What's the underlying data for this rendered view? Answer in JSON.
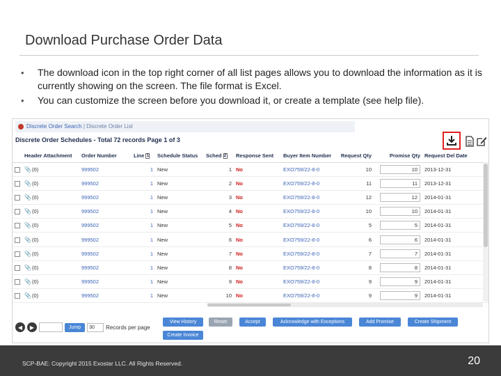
{
  "slide": {
    "title": "Download Purchase Order Data",
    "bullets": [
      "The download icon in the top right corner of all list pages allows you to download the information as it is currently showing on the screen.  The file format is Excel.",
      "You can customize the screen before you download it, or create a template (see help file)."
    ],
    "footer_text": "SCP-BAE:  Copyright 2015 Exostar LLC. All Rights Reserved.",
    "page_number": "20"
  },
  "app": {
    "breadcrumb": {
      "link": "Discrete Order Search",
      "separator": " | ",
      "current": "Discrete Order List"
    },
    "panel_title": "Discrete Order Schedules - Total 72 records Page 1 of 3",
    "toolbar_icons": [
      "download-icon",
      "document-icon",
      "edit-icon"
    ],
    "columns": [
      "Header Attachment",
      "Order Number",
      "Line",
      "Schedule Status",
      "Sched",
      "Response Sent",
      "Buyer Item Number",
      "Request Qty",
      "Promise Qty",
      "Request Del Date"
    ],
    "rows": [
      {
        "attachment": "(0)",
        "order": "999502",
        "line": "1",
        "status": "New",
        "sched": "1",
        "response": "No",
        "item": "EXO759/22-8-0",
        "req_qty": "10",
        "promise_qty": "10",
        "date": "2013-12-31"
      },
      {
        "attachment": "(0)",
        "order": "999502",
        "line": "1",
        "status": "New",
        "sched": "2",
        "response": "No",
        "item": "EXO759/22-8-0",
        "req_qty": "11",
        "promise_qty": "11",
        "date": "2013-12-31"
      },
      {
        "attachment": "(0)",
        "order": "999502",
        "line": "1",
        "status": "New",
        "sched": "3",
        "response": "No",
        "item": "EXO759/22-8-0",
        "req_qty": "12",
        "promise_qty": "12",
        "date": "2014-01-31"
      },
      {
        "attachment": "(0)",
        "order": "999502",
        "line": "1",
        "status": "New",
        "sched": "4",
        "response": "No",
        "item": "EXO759/22-8-0",
        "req_qty": "10",
        "promise_qty": "10",
        "date": "2014-01-31"
      },
      {
        "attachment": "(0)",
        "order": "999502",
        "line": "1",
        "status": "New",
        "sched": "5",
        "response": "No",
        "item": "EXO759/22-8-0",
        "req_qty": "5",
        "promise_qty": "5",
        "date": "2014-01-31"
      },
      {
        "attachment": "(0)",
        "order": "999502",
        "line": "1",
        "status": "New",
        "sched": "6",
        "response": "No",
        "item": "EXO759/22-8-0",
        "req_qty": "6",
        "promise_qty": "6",
        "date": "2014-01-31"
      },
      {
        "attachment": "(0)",
        "order": "999502",
        "line": "1",
        "status": "New",
        "sched": "7",
        "response": "No",
        "item": "EXO759/22-8-0",
        "req_qty": "7",
        "promise_qty": "7",
        "date": "2014-01-31"
      },
      {
        "attachment": "(0)",
        "order": "999502",
        "line": "1",
        "status": "New",
        "sched": "8",
        "response": "No",
        "item": "EXO759/22-8-0",
        "req_qty": "8",
        "promise_qty": "8",
        "date": "2014-01-31"
      },
      {
        "attachment": "(0)",
        "order": "999502",
        "line": "1",
        "status": "New",
        "sched": "9",
        "response": "No",
        "item": "EXO759/22-8-0",
        "req_qty": "9",
        "promise_qty": "9",
        "date": "2014-01-31"
      },
      {
        "attachment": "(0)",
        "order": "999502",
        "line": "1",
        "status": "New",
        "sched": "10",
        "response": "No",
        "item": "EXO759/22-8-0",
        "req_qty": "9",
        "promise_qty": "9",
        "date": "2014-01-31"
      }
    ],
    "pager": {
      "jump_label": "Jump",
      "page_size": "30",
      "records_label": "Records per page"
    },
    "actions": {
      "view_history": "View History",
      "reset": "Reset",
      "accept": "Accept",
      "acknowledge": "Acknowledge with Exceptions",
      "add_promise": "Add Promise",
      "create_shipment": "Create Shipment",
      "create_invoice": "Create Invoice"
    }
  },
  "colors": {
    "highlight": "#e02020",
    "link": "#3a63b5",
    "button": "#4a86d6",
    "status_no": "#d01c1c",
    "footer": "#3b3b3b"
  }
}
